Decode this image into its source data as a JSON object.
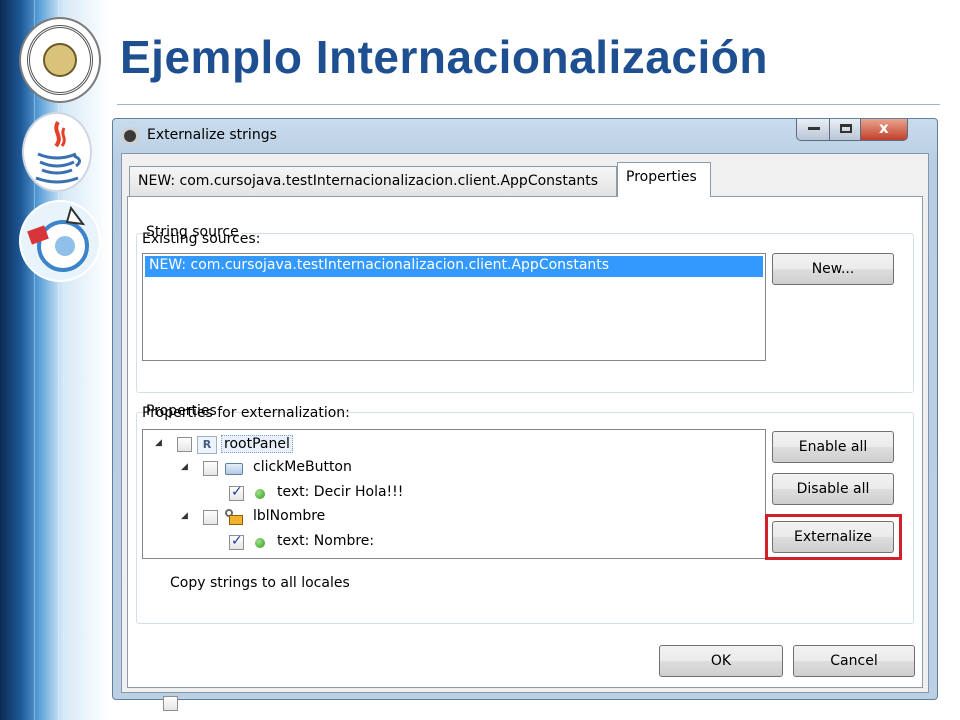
{
  "slide": {
    "title": "Ejemplo Internacionalización"
  },
  "dialog": {
    "window_title": "Externalize strings",
    "window_buttons": {
      "minimize_icon": "minimize-icon",
      "maximize_icon": "maximize-icon",
      "close_icon": "close-icon",
      "close_glyph": "x"
    },
    "tabs": [
      {
        "label": "NEW: com.cursojava.testInternacionalizacion.client.AppConstants",
        "selected": false
      },
      {
        "label": "Properties",
        "selected": true
      }
    ],
    "string_source": {
      "group_label": "String source",
      "existing_label": "Existing sources:",
      "sources": [
        "NEW: com.cursojava.testInternacionalizacion.client.AppConstants"
      ],
      "new_button": "New..."
    },
    "properties": {
      "group_label": "Properties",
      "list_label": "Properties for externalization:",
      "tree": [
        {
          "label": "rootPanel",
          "icon": "R",
          "checked": false,
          "level": 0
        },
        {
          "label": "clickMeButton",
          "icon": "button-icon",
          "checked": false,
          "level": 1
        },
        {
          "label": "text: Decir Hola!!!",
          "icon": "property-dot-icon",
          "checked": true,
          "level": 2
        },
        {
          "label": "lblNombre",
          "icon": "label-icon",
          "checked": false,
          "level": 1
        },
        {
          "label": "text: Nombre:",
          "icon": "property-dot-icon",
          "checked": true,
          "level": 2
        }
      ],
      "enable_all": "Enable all",
      "disable_all": "Disable all",
      "externalize": "Externalize"
    },
    "copy_strings_label": "Copy strings to all locales",
    "copy_strings_checked": false,
    "ok_button": "OK",
    "cancel_button": "Cancel"
  },
  "colors": {
    "title": "#1d4f91",
    "selection": "#3399ff",
    "highlight": "#d0202a"
  }
}
